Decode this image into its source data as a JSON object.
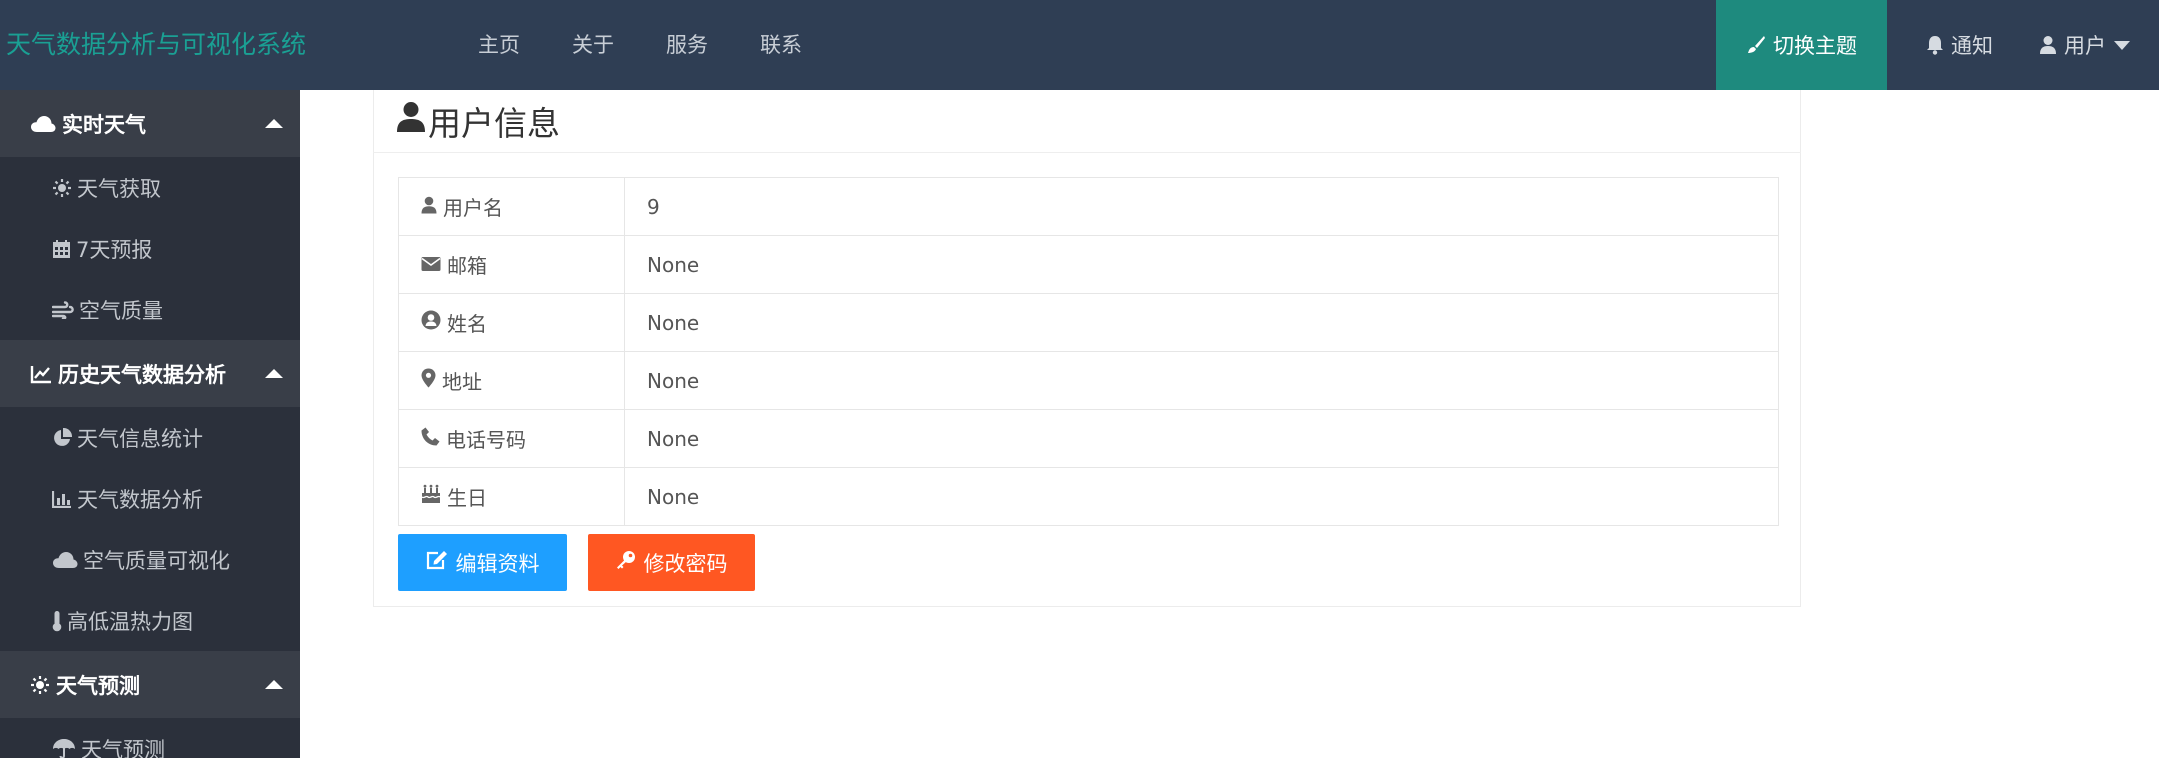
{
  "app": {
    "title": "天气数据分析与可视化系统"
  },
  "colors": {
    "header_bg": "#2f3e54",
    "logo": "#1aa094",
    "theme_active": "#1e8a7e",
    "sidebar_bg": "#2b303b",
    "edit_btn": "#1e9fff",
    "pwd_btn": "#ff5722"
  },
  "topnav": {
    "items": [
      "主页",
      "关于",
      "服务",
      "联系"
    ]
  },
  "right_nav": {
    "theme": "切换主题",
    "notify": "通知",
    "user": "用户"
  },
  "sidebar": {
    "groups": [
      {
        "label": "实时天气",
        "icon": "cloud-icon",
        "items": [
          {
            "label": "天气获取",
            "icon": "sun-icon"
          },
          {
            "label": "7天预报",
            "icon": "calendar-icon"
          },
          {
            "label": "空气质量",
            "icon": "wind-icon"
          }
        ]
      },
      {
        "label": "历史天气数据分析",
        "icon": "line-chart-icon",
        "items": [
          {
            "label": "天气信息统计",
            "icon": "pie-chart-icon"
          },
          {
            "label": "天气数据分析",
            "icon": "bar-chart-icon"
          },
          {
            "label": "空气质量可视化",
            "icon": "cloud-icon"
          },
          {
            "label": "高低温热力图",
            "icon": "thermometer-icon"
          }
        ]
      },
      {
        "label": "天气预测",
        "icon": "sun-icon",
        "items": [
          {
            "label": "天气预测",
            "icon": "umbrella-icon"
          }
        ]
      }
    ]
  },
  "main": {
    "title": "用户信息",
    "rows": [
      {
        "label": "用户名",
        "icon": "user-icon",
        "value": "9"
      },
      {
        "label": "邮箱",
        "icon": "envelope-icon",
        "value": "None"
      },
      {
        "label": "姓名",
        "icon": "user-circle-icon",
        "value": "None"
      },
      {
        "label": "地址",
        "icon": "map-marker-icon",
        "value": "None"
      },
      {
        "label": "电话号码",
        "icon": "phone-icon",
        "value": "None"
      },
      {
        "label": "生日",
        "icon": "birthday-cake-icon",
        "value": "None"
      }
    ],
    "buttons": {
      "edit": "编辑资料",
      "password": "修改密码"
    }
  }
}
